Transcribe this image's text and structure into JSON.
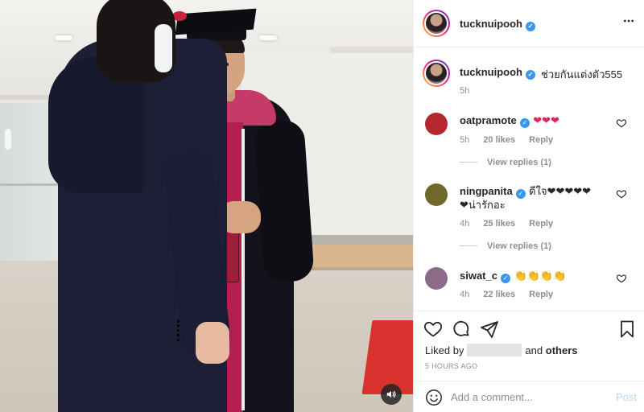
{
  "header": {
    "username": "tucknuipooh"
  },
  "caption": {
    "username": "tucknuipooh",
    "text": "ช่วยกันแต่งตัว555",
    "time": "5h"
  },
  "comments": [
    {
      "username": "oatpramote",
      "verified": true,
      "text": "❤❤❤",
      "text2": "",
      "time": "5h",
      "likes": "20 likes",
      "reply": "Reply",
      "view_replies": "View replies (1)",
      "avatar_color": "#b3272d"
    },
    {
      "username": "ningpanita",
      "verified": true,
      "text": "ดีใจ❤❤❤❤❤",
      "text2": "❤น่ารักอะ",
      "time": "4h",
      "likes": "25 likes",
      "reply": "Reply",
      "view_replies": "View replies (1)",
      "avatar_color": "#6f6a2a"
    },
    {
      "username": "siwat_c",
      "verified": true,
      "text": "👏👏👏👏",
      "text2": "",
      "time": "4h",
      "likes": "22 likes",
      "reply": "Reply",
      "view_replies": "",
      "avatar_color": "#8c6a8a"
    }
  ],
  "actions": {
    "liked_prefix": "Liked by",
    "liked_and": "and",
    "liked_others": "others",
    "post_time": "5 HOURS AGO"
  },
  "add_comment": {
    "placeholder": "Add a comment...",
    "post_label": "Post"
  },
  "icons": {
    "like": "heart-icon",
    "comment": "comment-icon",
    "share": "share-icon",
    "save": "bookmark-icon",
    "more": "more-icon",
    "volume": "volume-icon",
    "emoji": "emoji-icon"
  },
  "colors": {
    "verified": "#3897f0",
    "heart": "#e0245e",
    "post_disabled": "#b3dbff",
    "muted": "#8e8e8e"
  }
}
